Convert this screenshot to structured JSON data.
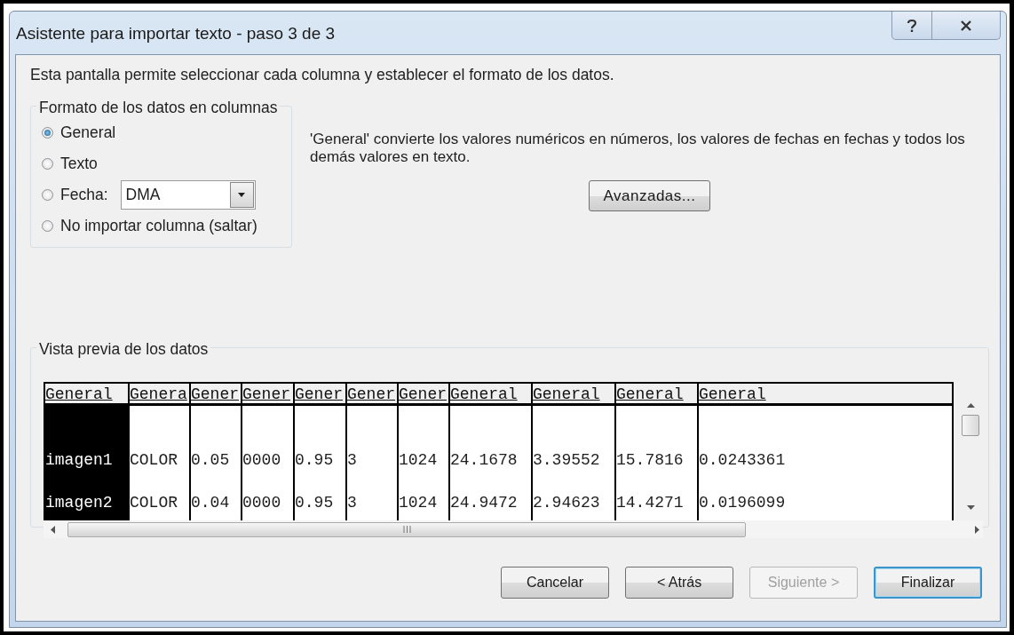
{
  "window": {
    "title": "Asistente para importar texto - paso 3 de 3"
  },
  "intro": "Esta pantalla permite seleccionar cada columna y establecer el formato de los datos.",
  "format_group": {
    "title": "Formato de los datos en columnas",
    "options": [
      {
        "label": "General",
        "selected": true
      },
      {
        "label": "Texto",
        "selected": false
      },
      {
        "label": "Fecha:",
        "selected": false,
        "dropdown": {
          "value": "DMA"
        }
      },
      {
        "label": "No importar columna (saltar)",
        "selected": false
      }
    ]
  },
  "description": "'General' convierte los valores numéricos en números, los valores de fechas en fechas y todos los demás valores en texto.",
  "advanced_button": "Avanzadas...",
  "preview": {
    "title": "Vista previa de los datos",
    "columns": [
      {
        "header": "General",
        "selected": true
      },
      {
        "header": "Genera",
        "selected": false
      },
      {
        "header": "Gener",
        "selected": false
      },
      {
        "header": "Gener",
        "selected": false
      },
      {
        "header": "Gener",
        "selected": false
      },
      {
        "header": "Gener",
        "selected": false
      },
      {
        "header": "Gener",
        "selected": false
      },
      {
        "header": "General",
        "selected": false
      },
      {
        "header": "General",
        "selected": false
      },
      {
        "header": "General",
        "selected": false
      },
      {
        "header": "General",
        "selected": false
      }
    ],
    "rows": [
      [
        "imagen1",
        "COLOR",
        "0.05",
        "0000",
        "0.95",
        "3",
        "1024",
        "24.1678",
        "3.39552",
        "15.7816",
        "0.0243361"
      ],
      [
        "imagen2",
        "COLOR",
        "0.04",
        "0000",
        "0.95",
        "3",
        "1024",
        "24.9472",
        "2.94623",
        "14.4271",
        "0.0196099"
      ]
    ]
  },
  "buttons": [
    {
      "label": "Cancelar",
      "disabled": false,
      "default": false
    },
    {
      "label": "< Atrás",
      "disabled": false,
      "default": false
    },
    {
      "label": "Siguiente >",
      "disabled": true,
      "default": false
    },
    {
      "label": "Finalizar",
      "disabled": false,
      "default": true
    }
  ]
}
